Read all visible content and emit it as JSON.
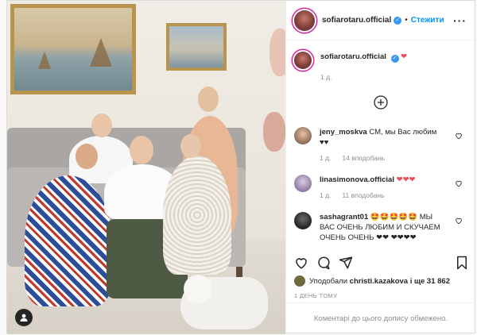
{
  "post": {
    "author": "sofiarotaru.official",
    "follow_label": "Стежити",
    "separator": "•",
    "more_label": "···",
    "caption_emoji": "❤",
    "caption_time": "1 д."
  },
  "comments": [
    {
      "user": "jeny_moskva",
      "text": "СМ, мы Вас любим ♥♥",
      "time": "1 д.",
      "likes": "14 вподобань"
    },
    {
      "user": "linasimonova.official",
      "text": "❤❤❤",
      "time": "1 д.",
      "likes": "11 вподобань"
    },
    {
      "user": "sashagrant01",
      "text": "🤩🤩🤩🤩🤩 МЫ ВАС ОЧЕНЬ ЛЮБИМ И СКУЧАЕМ ОЧЕНЬ ОЧЕНЬ ❤❤ ❤❤❤❤",
      "time": "",
      "likes": ""
    }
  ],
  "likes": {
    "prefix": "Уподобали",
    "user": "christi.kazakova",
    "suffix": "і ще 31 862"
  },
  "date": "1 ДЕНЬ ТОМУ",
  "comments_closed": "Коментарі до цього допису обмежено.",
  "colors": {
    "accent": "#0095f6",
    "heart": "#ed4956",
    "verified": "#3897f0"
  },
  "icons": [
    "heart-icon",
    "comment-icon",
    "share-icon",
    "bookmark-icon",
    "add-comment-icon",
    "tag-user-icon",
    "verified-icon"
  ]
}
